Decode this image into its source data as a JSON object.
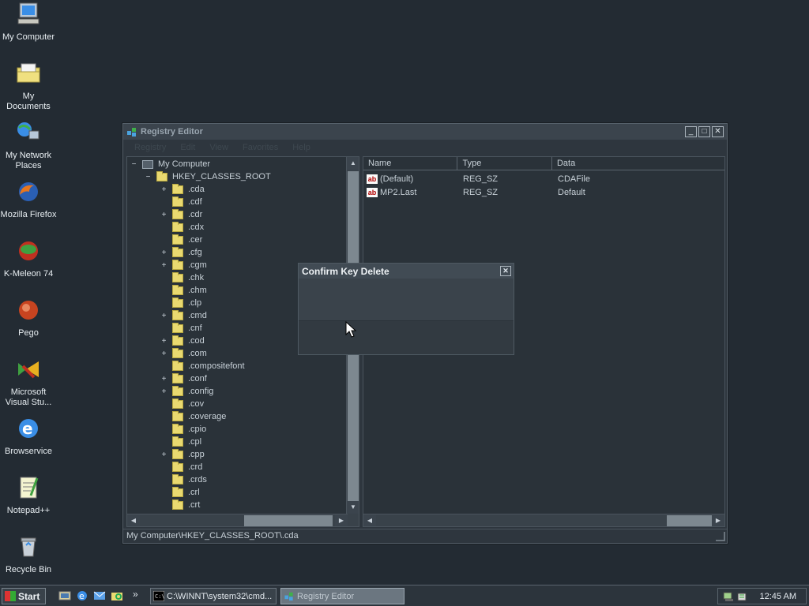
{
  "desktop": {
    "icons": [
      {
        "label": "My Computer",
        "icon": "my-computer-icon"
      },
      {
        "label": "My Documents",
        "icon": "my-documents-icon"
      },
      {
        "label": "My Network Places",
        "icon": "network-places-icon"
      },
      {
        "label": "Mozilla Firefox",
        "icon": "firefox-icon"
      },
      {
        "label": "K-Meleon 74",
        "icon": "k-meleon-icon"
      },
      {
        "label": "Pego",
        "icon": "pego-icon"
      },
      {
        "label": "Microsoft Visual Stu...",
        "icon": "visual-studio-icon"
      },
      {
        "label": "Browservice",
        "icon": "internet-explorer-icon"
      },
      {
        "label": "Notepad++",
        "icon": "notepad-plus-plus-icon"
      },
      {
        "label": "Recycle Bin",
        "icon": "recycle-bin-icon"
      }
    ]
  },
  "window": {
    "title": "Registry Editor",
    "controls": {
      "minimize": "_",
      "maximize": "□",
      "close": "✕"
    },
    "menu": [
      "Registry",
      "Edit",
      "View",
      "Favorites",
      "Help"
    ],
    "tree": {
      "root": "My Computer",
      "hive": "HKEY_CLASSES_ROOT",
      "keys": [
        {
          "name": ".cda",
          "expandable": true,
          "open": true
        },
        {
          "name": ".cdf",
          "expandable": false
        },
        {
          "name": ".cdr",
          "expandable": true
        },
        {
          "name": ".cdx",
          "expandable": false
        },
        {
          "name": ".cer",
          "expandable": false
        },
        {
          "name": ".cfg",
          "expandable": true
        },
        {
          "name": ".cgm",
          "expandable": true
        },
        {
          "name": ".chk",
          "expandable": false
        },
        {
          "name": ".chm",
          "expandable": false
        },
        {
          "name": ".clp",
          "expandable": false
        },
        {
          "name": ".cmd",
          "expandable": true
        },
        {
          "name": ".cnf",
          "expandable": false
        },
        {
          "name": ".cod",
          "expandable": true
        },
        {
          "name": ".com",
          "expandable": true
        },
        {
          "name": ".compositefont",
          "expandable": false
        },
        {
          "name": ".conf",
          "expandable": true
        },
        {
          "name": ".config",
          "expandable": true
        },
        {
          "name": ".cov",
          "expandable": false
        },
        {
          "name": ".coverage",
          "expandable": false
        },
        {
          "name": ".cpio",
          "expandable": false
        },
        {
          "name": ".cpl",
          "expandable": false
        },
        {
          "name": ".cpp",
          "expandable": true
        },
        {
          "name": ".crd",
          "expandable": false
        },
        {
          "name": ".crds",
          "expandable": false
        },
        {
          "name": ".crl",
          "expandable": false
        },
        {
          "name": ".crt",
          "expandable": false
        }
      ]
    },
    "list": {
      "columns": [
        "Name",
        "Type",
        "Data"
      ],
      "rows": [
        {
          "name": "(Default)",
          "type": "REG_SZ",
          "data": "CDAFile"
        },
        {
          "name": "MP2.Last",
          "type": "REG_SZ",
          "data": "Default"
        }
      ]
    },
    "status": "My Computer\\HKEY_CLASSES_ROOT\\.cda"
  },
  "dialog": {
    "title": "Confirm Key Delete",
    "close": "✕"
  },
  "taskbar": {
    "start_label": "Start",
    "overflow": "»",
    "tasks": [
      {
        "label": "C:\\WINNT\\system32\\cmd...",
        "active": false
      },
      {
        "label": "Registry Editor",
        "active": true
      }
    ],
    "clock": "12:45 AM"
  },
  "colors": {
    "desktop_bg": "#232b33",
    "folder": "#e9d970",
    "window_bg": "#2e363e"
  }
}
